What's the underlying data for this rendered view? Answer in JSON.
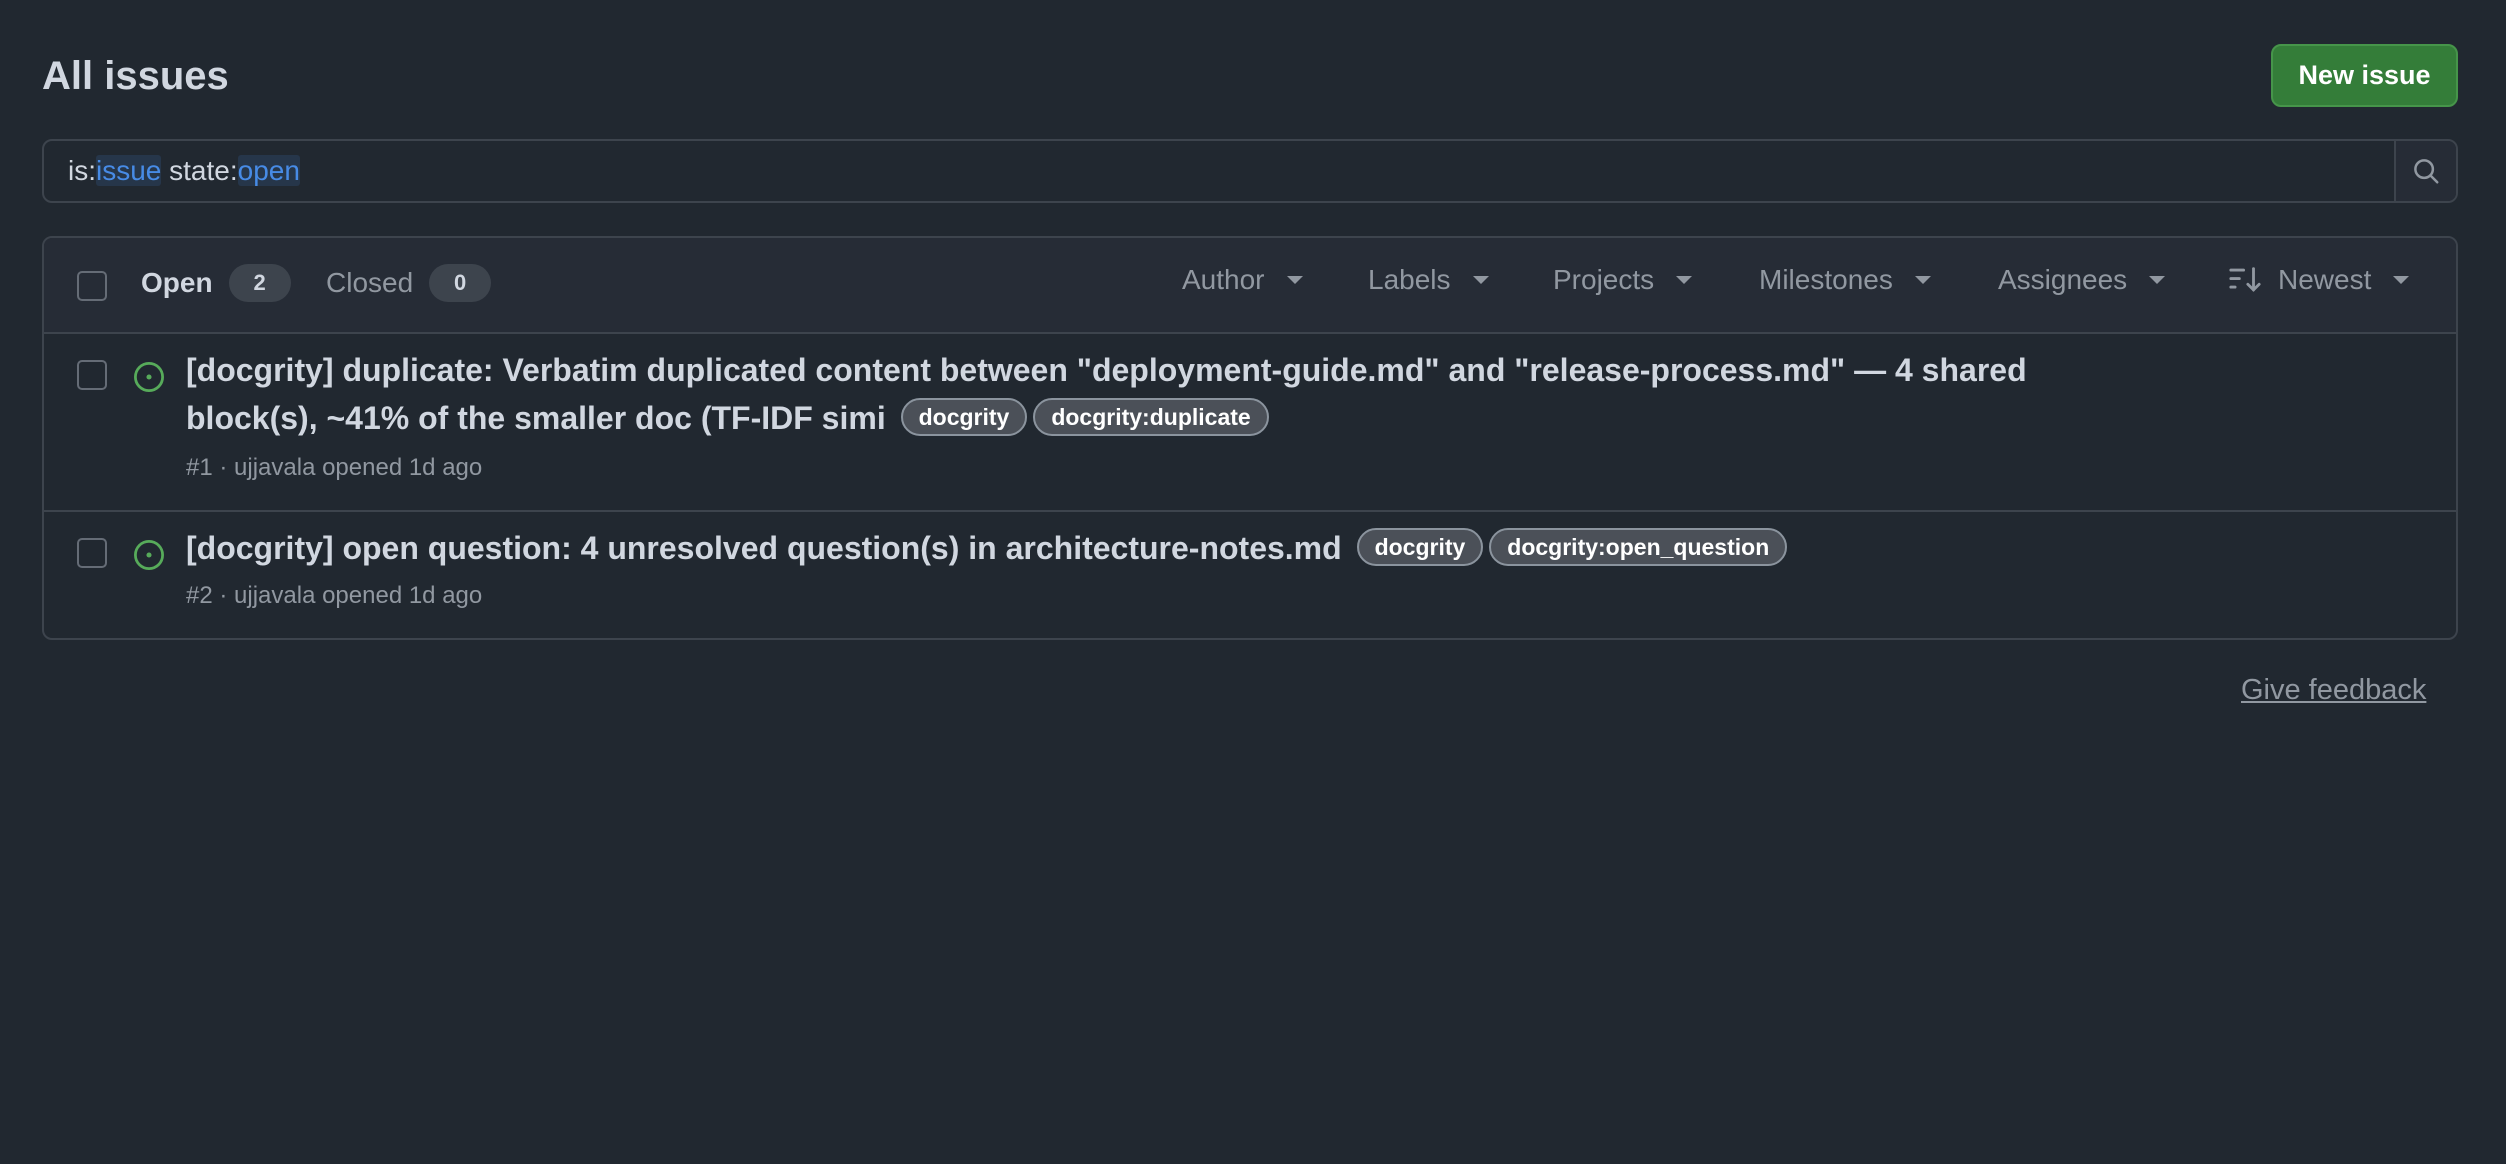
{
  "header": {
    "title": "All issues",
    "new_issue_label": "New issue"
  },
  "search": {
    "prefix_1": "is:",
    "value_1": "issue",
    "prefix_2": " state:",
    "value_2": "open"
  },
  "toolbar": {
    "open_label": "Open",
    "open_count": "2",
    "closed_label": "Closed",
    "closed_count": "0",
    "filters": {
      "author": "Author",
      "labels": "Labels",
      "projects": "Projects",
      "milestones": "Milestones",
      "assignees": "Assignees",
      "sort": "Newest"
    }
  },
  "issues": [
    {
      "title": "[docgrity] duplicate: Verbatim duplicated content between \"deployment-guide.md\" and \"release-process.md\" — 4 shared block(s), ~41% of the smaller doc (TF-IDF simi",
      "labels": [
        "docgrity",
        "docgrity:duplicate"
      ],
      "meta": "#1 · ujjavala opened 1d ago"
    },
    {
      "title": "[docgrity] open question: 4 unresolved question(s) in architecture-notes.md",
      "labels": [
        "docgrity",
        "docgrity:open_question"
      ],
      "meta": "#2 · ujjavala opened 1d ago"
    }
  ],
  "footer": {
    "feedback": "Give feedback"
  },
  "colors": {
    "background": "#212830",
    "primary_button": "#347d39",
    "link_accent": "#478be6",
    "open_state": "#57ab5a"
  },
  "icons": {
    "search": "search-icon",
    "sort": "sort-icon",
    "issue_state": "issue-opened-icon",
    "dropdown": "caret-down-icon"
  }
}
